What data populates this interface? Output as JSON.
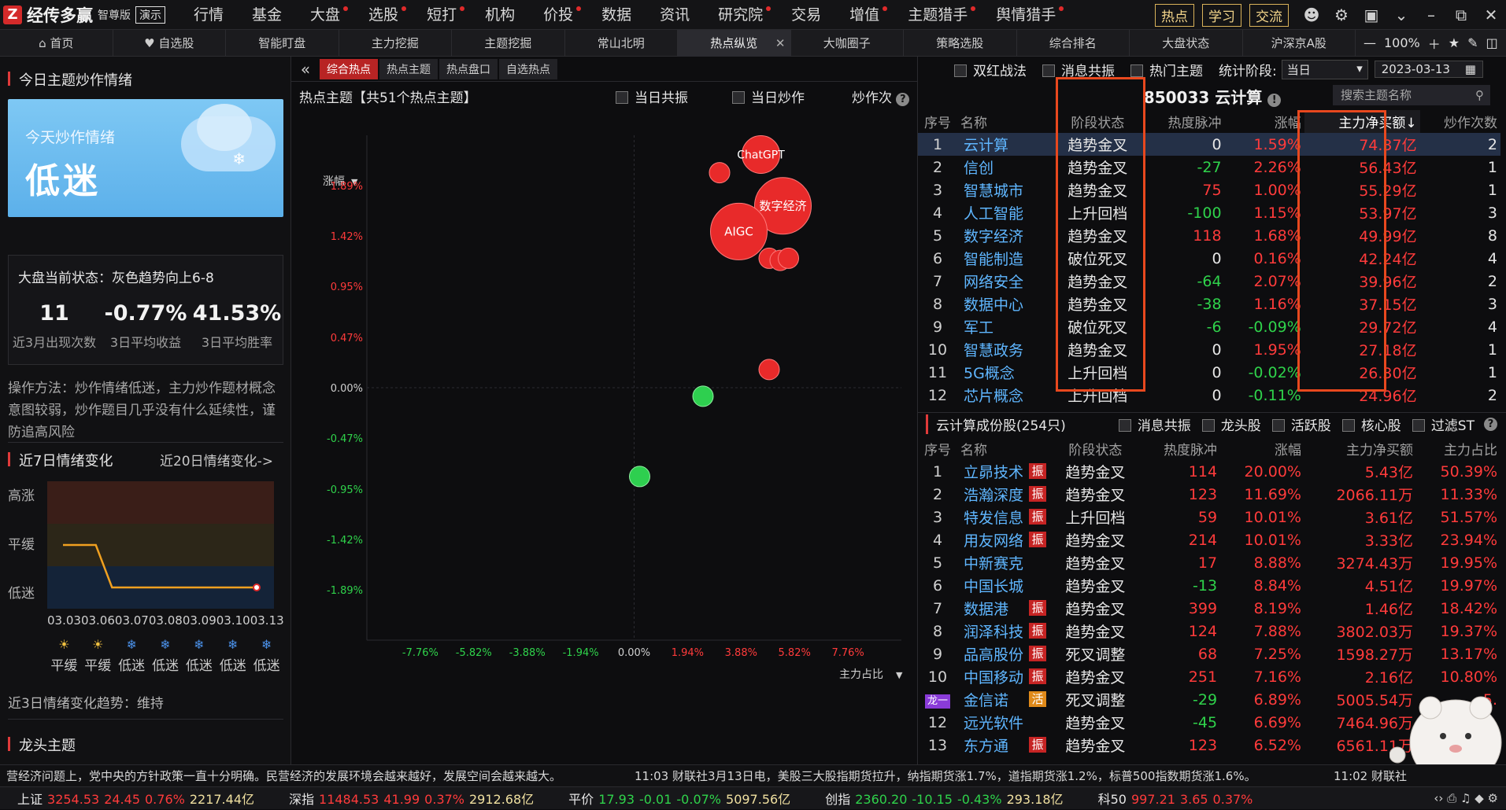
{
  "app": {
    "logo_mark": "Z",
    "name": "经传多赢",
    "edition": "智尊版",
    "demo": "演示"
  },
  "menu": [
    {
      "label": "行情",
      "dot": false
    },
    {
      "label": "基金",
      "dot": false
    },
    {
      "label": "大盘",
      "dot": true
    },
    {
      "label": "选股",
      "dot": true
    },
    {
      "label": "短打",
      "dot": true
    },
    {
      "label": "机构",
      "dot": false
    },
    {
      "label": "价投",
      "dot": true
    },
    {
      "label": "数据",
      "dot": false
    },
    {
      "label": "资讯",
      "dot": false
    },
    {
      "label": "研究院",
      "dot": true
    },
    {
      "label": "交易",
      "dot": false
    },
    {
      "label": "增值",
      "dot": true
    },
    {
      "label": "主题猎手",
      "dot": true
    },
    {
      "label": "舆情猎手",
      "dot": true
    }
  ],
  "menu_right": {
    "hot": "热点",
    "learn": "学习",
    "exchange": "交流"
  },
  "tabs": [
    "首页",
    "自选股",
    "智能盯盘",
    "主力挖掘",
    "主题挖掘",
    "常山北明",
    "热点纵览",
    "大咖圈子",
    "策略选股",
    "综合排名",
    "大盘状态",
    "沪深京A股"
  ],
  "tabs_active_index": 6,
  "zoom": "100%",
  "left": {
    "sec1_title": "今日主题炒作情绪",
    "banner_label": "今天炒作情绪",
    "banner_value": "低迷",
    "market_state": "大盘当前状态：灰色趋势向上6-8",
    "stats": [
      {
        "value": "11",
        "label": "近3月出现次数"
      },
      {
        "value": "-0.77%",
        "label": "3日平均收益"
      },
      {
        "value": "41.53%",
        "label": "3日平均胜率"
      }
    ],
    "op_desc": "操作方法：炒作情绪低迷，主力炒作题材概念意图较弱，炒作题目几乎没有什么延续性，谨防追高风险",
    "sec2_title": "近7日情绪变化",
    "link20": "近20日情绪变化->",
    "levels": [
      "高涨",
      "平缓",
      "低迷"
    ],
    "dates": [
      "03.03",
      "03.06",
      "03.07",
      "03.08",
      "03.09",
      "03.10",
      "03.13"
    ],
    "moods": [
      "平缓",
      "平缓",
      "低迷",
      "低迷",
      "低迷",
      "低迷",
      "低迷"
    ],
    "trend3": "近3日情绪变化趋势：维持",
    "sec3_title": "龙头主题"
  },
  "mid": {
    "subtabs": [
      "综合热点",
      "热点主题",
      "热点盘口",
      "自选热点"
    ],
    "header": "热点主题【共51个热点主题】",
    "opt1": "当日共振",
    "opt2": "当日炒作",
    "opt3": "炒作次",
    "y_axis_label": "涨幅",
    "x_axis_label": "主力占比"
  },
  "chart_data": {
    "type": "scatter",
    "x_ticks": [
      "-7.76%",
      "-5.82%",
      "-3.88%",
      "-1.94%",
      "0.00%",
      "1.94%",
      "3.88%",
      "5.82%",
      "7.76%"
    ],
    "y_ticks": [
      "1.89%",
      "1.42%",
      "0.95%",
      "0.47%",
      "0.00%",
      "-0.47%",
      "-0.95%",
      "-1.42%",
      "-1.89%"
    ],
    "xlim": [
      -9.7,
      9.7
    ],
    "ylim": [
      -2.36,
      2.36
    ],
    "points": [
      {
        "label": "",
        "x": 3.1,
        "y": 2.01,
        "size": 1,
        "color": "red"
      },
      {
        "label": "ChatGPT",
        "x": 4.6,
        "y": 2.18,
        "size": 2,
        "color": "red"
      },
      {
        "label": "数字经济",
        "x": 5.4,
        "y": 1.7,
        "size": 3,
        "color": "red"
      },
      {
        "label": "AIGC",
        "x": 3.8,
        "y": 1.46,
        "size": 3,
        "color": "red"
      },
      {
        "label": "",
        "x": 4.9,
        "y": 1.21,
        "size": 1,
        "color": "red"
      },
      {
        "label": "",
        "x": 5.3,
        "y": 1.19,
        "size": 1,
        "color": "red"
      },
      {
        "label": "",
        "x": 5.6,
        "y": 1.21,
        "size": 1,
        "color": "red"
      },
      {
        "label": "",
        "x": 4.9,
        "y": 0.17,
        "size": 1,
        "color": "red"
      },
      {
        "label": "",
        "x": 2.5,
        "y": -0.08,
        "size": 1,
        "color": "green"
      },
      {
        "label": "",
        "x": 0.2,
        "y": -0.83,
        "size": 1,
        "color": "green"
      }
    ]
  },
  "right": {
    "opts": [
      "双红战法",
      "消息共振",
      "热门主题"
    ],
    "stage_label": "统计阶段:",
    "stage_value": "当日",
    "date": "2023-03-13",
    "title": "850033 云计算",
    "search_placeholder": "搜索主题名称",
    "columns": [
      "序号",
      "名称",
      "阶段状态",
      "热度脉冲",
      "涨幅",
      "主力净买额↓",
      "炒作次数"
    ],
    "rows": [
      {
        "idx": "1",
        "name": "云计算",
        "stage": "趋势金叉",
        "heat": "0",
        "chg": "1.59%",
        "net": "74.37亿",
        "times": "2"
      },
      {
        "idx": "2",
        "name": "信创",
        "stage": "趋势金叉",
        "heat": "-27",
        "chg": "2.26%",
        "net": "56.43亿",
        "times": "1"
      },
      {
        "idx": "3",
        "name": "智慧城市",
        "stage": "趋势金叉",
        "heat": "75",
        "chg": "1.00%",
        "net": "55.29亿",
        "times": "1"
      },
      {
        "idx": "4",
        "name": "人工智能",
        "stage": "上升回档",
        "heat": "-100",
        "chg": "1.15%",
        "net": "53.97亿",
        "times": "3"
      },
      {
        "idx": "5",
        "name": "数字经济",
        "stage": "趋势金叉",
        "heat": "118",
        "chg": "1.68%",
        "net": "49.99亿",
        "times": "8"
      },
      {
        "idx": "6",
        "name": "智能制造",
        "stage": "破位死叉",
        "heat": "0",
        "chg": "0.16%",
        "net": "42.24亿",
        "times": "4"
      },
      {
        "idx": "7",
        "name": "网络安全",
        "stage": "趋势金叉",
        "heat": "-64",
        "chg": "2.07%",
        "net": "39.96亿",
        "times": "2"
      },
      {
        "idx": "8",
        "name": "数据中心",
        "stage": "趋势金叉",
        "heat": "-38",
        "chg": "1.16%",
        "net": "37.15亿",
        "times": "3"
      },
      {
        "idx": "9",
        "name": "军工",
        "stage": "破位死叉",
        "heat": "-6",
        "chg": "-0.09%",
        "net": "29.72亿",
        "times": "4"
      },
      {
        "idx": "10",
        "name": "智慧政务",
        "stage": "趋势金叉",
        "heat": "0",
        "chg": "1.95%",
        "net": "27.18亿",
        "times": "1"
      },
      {
        "idx": "11",
        "name": "5G概念",
        "stage": "上升回档",
        "heat": "0",
        "chg": "-0.02%",
        "net": "26.30亿",
        "times": "1"
      },
      {
        "idx": "12",
        "name": "芯片概念",
        "stage": "上升回档",
        "heat": "0",
        "chg": "-0.11%",
        "net": "24.96亿",
        "times": "2"
      }
    ],
    "comp_title": "云计算成份股(254只)",
    "comp_opts": [
      "消息共振",
      "龙头股",
      "活跃股",
      "核心股",
      "过滤ST"
    ],
    "comp_columns": [
      "序号",
      "名称",
      "阶段状态",
      "热度脉冲",
      "涨幅",
      "主力净买额",
      "主力占比"
    ],
    "comp_rows": [
      {
        "idx": "1",
        "name": "立昴技术",
        "tag": "振",
        "stage": "趋势金叉",
        "heat": "114",
        "chg": "20.00%",
        "net": "5.43亿",
        "ratio": "50.39%"
      },
      {
        "idx": "2",
        "name": "浩瀚深度",
        "tag": "振",
        "stage": "趋势金叉",
        "heat": "123",
        "chg": "11.69%",
        "net": "2066.11万",
        "ratio": "11.33%"
      },
      {
        "idx": "3",
        "name": "特发信息",
        "tag": "振",
        "stage": "上升回档",
        "heat": "59",
        "chg": "10.01%",
        "net": "3.61亿",
        "ratio": "51.57%"
      },
      {
        "idx": "4",
        "name": "用友网络",
        "tag": "振",
        "stage": "趋势金叉",
        "heat": "214",
        "chg": "10.01%",
        "net": "3.33亿",
        "ratio": "23.94%"
      },
      {
        "idx": "5",
        "name": "中新赛克",
        "tag": "",
        "stage": "趋势金叉",
        "heat": "17",
        "chg": "8.88%",
        "net": "3274.43万",
        "ratio": "19.95%"
      },
      {
        "idx": "6",
        "name": "中国长城",
        "tag": "",
        "stage": "趋势金叉",
        "heat": "-13",
        "chg": "8.84%",
        "net": "4.51亿",
        "ratio": "19.97%"
      },
      {
        "idx": "7",
        "name": "数据港",
        "tag": "振",
        "stage": "趋势金叉",
        "heat": "399",
        "chg": "8.19%",
        "net": "1.46亿",
        "ratio": "18.42%"
      },
      {
        "idx": "8",
        "name": "润泽科技",
        "tag": "振",
        "stage": "趋势金叉",
        "heat": "124",
        "chg": "7.88%",
        "net": "3802.03万",
        "ratio": "19.37%"
      },
      {
        "idx": "9",
        "name": "品高股份",
        "tag": "振",
        "stage": "死叉调整",
        "heat": "68",
        "chg": "7.25%",
        "net": "1598.27万",
        "ratio": "13.17%"
      },
      {
        "idx": "10",
        "name": "中国移动",
        "tag": "振",
        "stage": "趋势金叉",
        "heat": "251",
        "chg": "7.16%",
        "net": "2.16亿",
        "ratio": "10.80%"
      },
      {
        "idx": "龙一",
        "name": "金信诺",
        "tag": "活",
        "stage": "死叉调整",
        "heat": "-29",
        "chg": "6.89%",
        "net": "5005.54万",
        "ratio": "5."
      },
      {
        "idx": "12",
        "name": "远光软件",
        "tag": "",
        "stage": "趋势金叉",
        "heat": "-45",
        "chg": "6.69%",
        "net": "7464.96万",
        "ratio": ""
      },
      {
        "idx": "13",
        "name": "东方通",
        "tag": "振",
        "stage": "趋势金叉",
        "heat": "123",
        "chg": "6.52%",
        "net": "6561.11万",
        "ratio": ""
      }
    ]
  },
  "news": {
    "left": "营经济问题上，党中央的方针政策一直十分明确。民营经济的发展环境会越来越好，发展空间会越来越大。",
    "mid": "11:03 财联社3月13日电，美股三大股指期货拉升，纳指期货涨1.7%，道指期货涨1.2%，标普500指数期货涨1.6%。",
    "right": "11:02 财联社"
  },
  "indices": [
    {
      "name": "上证",
      "price": "3254.53",
      "chg": "24.45",
      "pct": "0.76%",
      "amt": "2217.44亿",
      "up": true
    },
    {
      "name": "深指",
      "price": "11484.53",
      "chg": "41.99",
      "pct": "0.37%",
      "amt": "2912.68亿",
      "up": true
    },
    {
      "name": "平价",
      "price": "17.93",
      "chg": "-0.01",
      "pct": "-0.07%",
      "amt": "5097.56亿",
      "up": false
    },
    {
      "name": "创指",
      "price": "2360.20",
      "chg": "-10.15",
      "pct": "-0.43%",
      "amt": "293.18亿",
      "up": false
    },
    {
      "name": "科50",
      "price": "997.21",
      "chg": "3.65",
      "pct": "0.37%",
      "amt": "",
      "up": true
    }
  ],
  "colors": {
    "accent_red": "#ff3b3b",
    "accent_green": "#2fd34b",
    "link_blue": "#5fb6ff",
    "highlight_box": "#e8481e"
  }
}
